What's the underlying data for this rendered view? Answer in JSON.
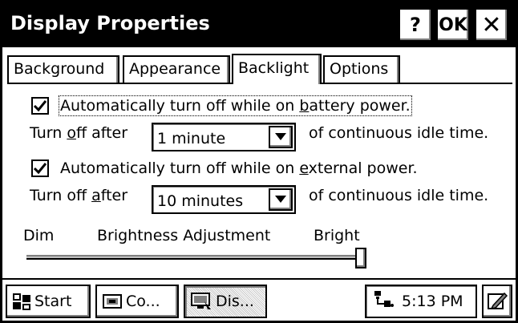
{
  "window": {
    "title": "Display Properties",
    "help_label": "?",
    "ok_label": "OK",
    "close_label": "✕"
  },
  "tabs": [
    {
      "label": "Background",
      "active": false
    },
    {
      "label": "Appearance",
      "active": false
    },
    {
      "label": "Backlight",
      "active": true
    },
    {
      "label": "Options",
      "active": false
    }
  ],
  "battery": {
    "checkbox_label_pre": "Automatically turn off while on ",
    "checkbox_label_u": "b",
    "checkbox_label_post": "attery power.",
    "checked": true,
    "turnoff_pre": "Turn ",
    "turnoff_u": "o",
    "turnoff_post": "ff after",
    "dropdown_value": "1 minute",
    "suffix": "of continuous idle time."
  },
  "external": {
    "checkbox_label_pre": "Automatically turn off while on ",
    "checkbox_label_u": "e",
    "checkbox_label_post": "xternal power.",
    "checked": true,
    "turnoff_pre": "Turn off ",
    "turnoff_u": "a",
    "turnoff_post": "fter",
    "dropdown_value": "10 minutes",
    "suffix": "of continuous idle time."
  },
  "brightness": {
    "dim_label": "Dim",
    "title": "Brightness Adjustment",
    "bright_label": "Bright",
    "level": 1.0
  },
  "taskbar": {
    "start_label": "Start",
    "items": [
      {
        "label": "Co...",
        "icon": "control-panel-icon",
        "pressed": false
      },
      {
        "label": "Dis...",
        "icon": "display-icon",
        "pressed": true
      }
    ],
    "time": "5:13 PM"
  }
}
